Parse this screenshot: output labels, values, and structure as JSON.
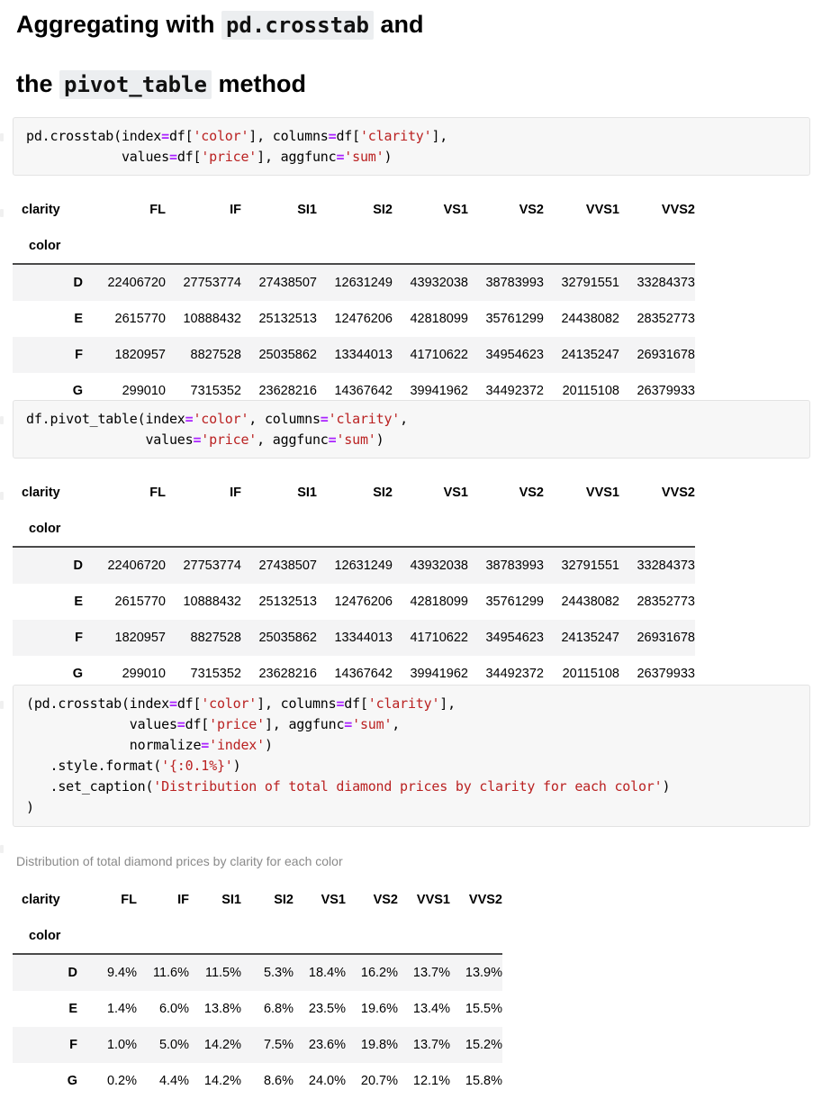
{
  "heading": {
    "line1_prefix": "Aggregating with ",
    "line1_code": "pd.crosstab",
    "line1_suffix": " and",
    "line2_prefix": "the ",
    "line2_code": "pivot_table",
    "line2_suffix": " method"
  },
  "code_cells": [
    {
      "id": "crosstab-sum",
      "lines": [
        "pd.crosstab(index=df['color'], columns=df['clarity'],",
        "            values=df['price'], aggfunc='sum')"
      ]
    },
    {
      "id": "pivot-table-sum",
      "lines": [
        "df.pivot_table(index='color', columns='clarity',",
        "               values='price', aggfunc='sum')"
      ]
    },
    {
      "id": "crosstab-normalized-styled",
      "lines": [
        "(pd.crosstab(index=df['color'], columns=df['clarity'],",
        "             values=df['price'], aggfunc='sum',",
        "             normalize='index')",
        "   .style.format('{:0.1%}')",
        "   .set_caption('Distribution of total diamond prices by clarity for each color')",
        ")"
      ]
    }
  ],
  "tables": {
    "columns_label": "clarity",
    "index_label": "color",
    "columns": [
      "FL",
      "IF",
      "SI1",
      "SI2",
      "VS1",
      "VS2",
      "VVS1",
      "VVS2"
    ],
    "index": [
      "D",
      "E",
      "F",
      "G"
    ],
    "sum_values": [
      [
        "22406720",
        "27753774",
        "27438507",
        "12631249",
        "43932038",
        "38783993",
        "32791551",
        "33284373"
      ],
      [
        "2615770",
        "10888432",
        "25132513",
        "12476206",
        "42818099",
        "35761299",
        "24438082",
        "28352773"
      ],
      [
        "1820957",
        "8827528",
        "25035862",
        "13344013",
        "41710622",
        "34954623",
        "24135247",
        "26931678"
      ],
      [
        "299010",
        "7315352",
        "23628216",
        "14367642",
        "39941962",
        "34492372",
        "20115108",
        "26379933"
      ]
    ],
    "percent_values": [
      [
        "9.4%",
        "11.6%",
        "11.5%",
        "5.3%",
        "18.4%",
        "16.2%",
        "13.7%",
        "13.9%"
      ],
      [
        "1.4%",
        "6.0%",
        "13.8%",
        "6.8%",
        "23.5%",
        "19.6%",
        "13.4%",
        "15.5%"
      ],
      [
        "1.0%",
        "5.0%",
        "14.2%",
        "7.5%",
        "23.6%",
        "19.8%",
        "13.7%",
        "15.2%"
      ],
      [
        "0.2%",
        "4.4%",
        "14.2%",
        "8.6%",
        "24.0%",
        "20.7%",
        "12.1%",
        "15.8%"
      ]
    ],
    "percent_caption": "Distribution of total diamond prices by clarity for each color"
  },
  "colors": {
    "string": "#ba2121",
    "operator": "#aa22ff",
    "code_background": "#f7f7f7",
    "stripe": "#f4f4f5",
    "caption": "#8a8a8a",
    "rule": "#4a4a4a"
  }
}
